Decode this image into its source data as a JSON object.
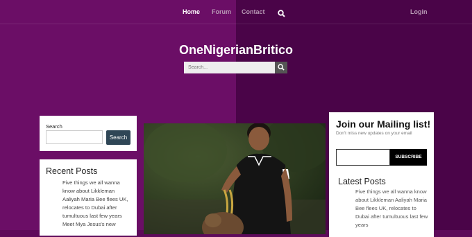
{
  "nav": {
    "home": "Home",
    "forum": "Forum",
    "contact": "Contact",
    "search_icon": "search-icon",
    "login": "Login"
  },
  "header": {
    "site_title": "OneNigerianBritico",
    "search_placeholder": "Search...",
    "search_button_icon": "search-icon"
  },
  "sidebar_left": {
    "search_label": "Search",
    "search_button": "Search",
    "recent_posts_title": "Recent Posts",
    "recent_posts_text": "Five things we all wanna know about Likkleman Aaliyah Maria Bee flees UK, relocates to Dubai after tumultuous last few years Meet Mya Jesus's new"
  },
  "main": {
    "featured_image": "man-walking-dog-photo"
  },
  "sidebar_right": {
    "mailing_title": "Join our Mailing list!",
    "mailing_subtitle": "Don't miss new updates on your email",
    "subscribe_button": "SUBSCRIBE",
    "latest_posts_title": "Latest Posts",
    "latest_posts_text": "Five things we all wanna know about Likkleman Aaliyah Maria Bee flees UK, relocates to Dubai after tumultuous last few years"
  },
  "colors": {
    "bg_left": "#6b0e66",
    "bg_right": "#4a0448",
    "search_button": "#2f4656"
  }
}
